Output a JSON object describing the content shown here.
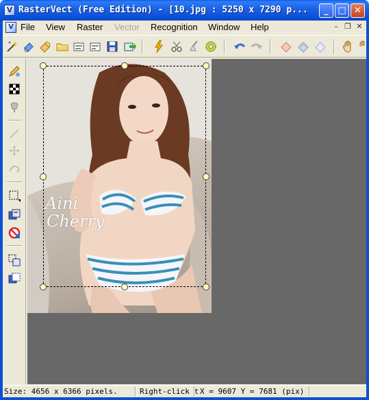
{
  "window": {
    "app_icon": "rastervect-icon",
    "title": "RasterVect (Free Edition) - [10.jpg : 5250 x 7290 p...",
    "minimize": "_",
    "maximize": "□",
    "close": "✕"
  },
  "menu": {
    "items": [
      {
        "label": "File",
        "enabled": true
      },
      {
        "label": "View",
        "enabled": true
      },
      {
        "label": "Raster",
        "enabled": true
      },
      {
        "label": "Vector",
        "enabled": false
      },
      {
        "label": "Recognition",
        "enabled": true
      },
      {
        "label": "Window",
        "enabled": true
      },
      {
        "label": "Help",
        "enabled": true
      }
    ],
    "mdi_minimize": "–",
    "mdi_restore": "❐",
    "mdi_close": "✕"
  },
  "toolbar_icons": [
    "magic-wand-icon",
    "erase-icon",
    "open-raster-icon",
    "open-folder-icon",
    "scan-icon",
    "scan-2-icon",
    "save-icon",
    "export-icon",
    "vectorize-icon",
    "cut-icon",
    "clear-icon",
    "settings-gear-icon",
    "undo-icon",
    "redo-icon",
    "eraser-pink-icon",
    "eraser-blue-icon",
    "eraser-light-icon",
    "hand-pan-icon",
    "hand-pan-2-icon"
  ],
  "toolbox_icons": [
    "pencil-brush-icon",
    "checker-pattern-icon",
    "fill-bucket-icon",
    "line-icon",
    "move-icon",
    "bezier-icon",
    "rect-select-icon",
    "copy-layer-icon",
    "no-entry-icon",
    "copy-select-icon",
    "paste-select-icon"
  ],
  "canvas": {
    "watermark_line1": "Aini",
    "watermark_line2": "Cherry"
  },
  "status": {
    "size": "Size: 4656 x 6366 pixels.",
    "hint": "Right-click t",
    "coords": "X = 9607   Y = 7681 (pix)"
  }
}
